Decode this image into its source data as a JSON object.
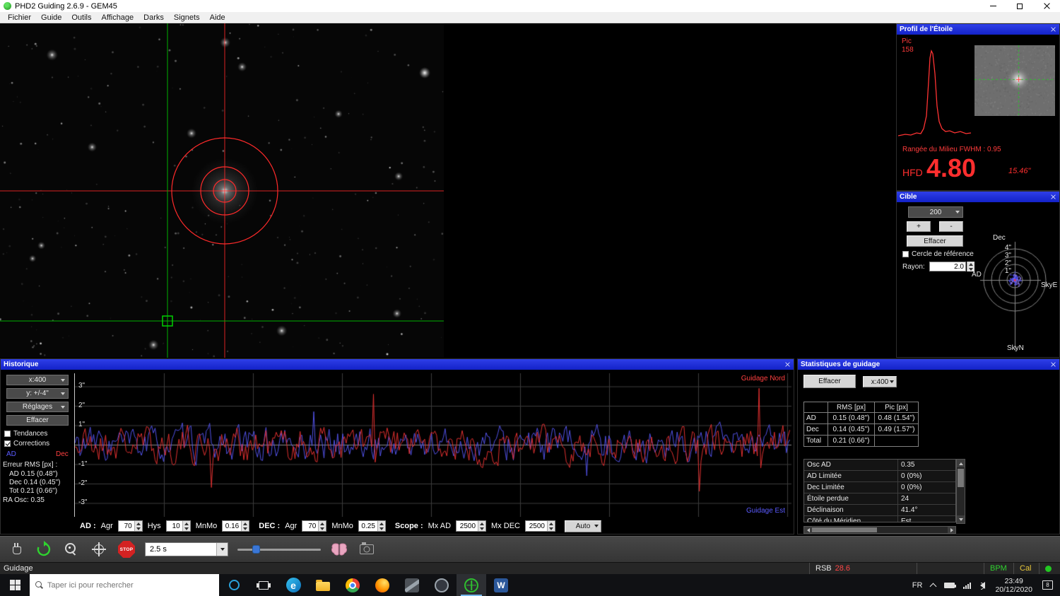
{
  "window": {
    "title": "PHD2 Guiding 2.6.9 - GEM45"
  },
  "menu": {
    "items": [
      "Fichier",
      "Guide",
      "Outils",
      "Affichage",
      "Darks",
      "Signets",
      "Aide"
    ]
  },
  "profile_panel": {
    "title": "Profil de l'Étoile",
    "peak_label": "Pic",
    "peak_value": "158",
    "fwhm_text": "Rangée du Milieu FWHM : 0.95",
    "hfd_label": "HFD",
    "hfd_value": "4.80",
    "hfd_arcsec": "15.46\""
  },
  "target_panel": {
    "title": "Cible",
    "zoom_value": "200",
    "zoom_in": "+",
    "zoom_out": "-",
    "clear_label": "Effacer",
    "ref_circle_label": "Cercle de référence",
    "radius_label": "Rayon:",
    "radius_value": "2.0",
    "axis_dec": "Dec",
    "axis_ad": "AD",
    "sky_east": "SkyE",
    "sky_north": "SkyN",
    "ring_labels": [
      "4\"",
      "3\"",
      "2\"",
      "1\""
    ]
  },
  "history_panel": {
    "title": "Historique",
    "scale_x": "x:400",
    "scale_y": "y: +/-4\"",
    "settings_label": "Réglages",
    "clear_label": "Effacer",
    "trend_label": "Tendances",
    "corrections_label": "Corrections",
    "ad_label": "AD",
    "dec_label": "Dec",
    "rms_title": "Erreur RMS [px] :",
    "rms_ad": "AD 0.15 (0.48\")",
    "rms_dec": "Dec 0.14 (0.45\")",
    "rms_tot": "Tot 0.21 (0.66\")",
    "ra_osc": "RA Osc: 0.35",
    "y_ticks": [
      "3\"",
      "2\"",
      "1\"",
      "-1\"",
      "-2\"",
      "-3\""
    ],
    "legend_north": "Guidage Nord",
    "legend_east": "Guidage Est",
    "param_groups": [
      {
        "group": "AD :",
        "fields": [
          {
            "label": "Agr",
            "value": "70"
          },
          {
            "label": "Hys",
            "value": "10"
          },
          {
            "label": "MnMo",
            "value": "0.16"
          }
        ]
      },
      {
        "group": "DEC :",
        "fields": [
          {
            "label": "Agr",
            "value": "70"
          },
          {
            "label": "MnMo",
            "value": "0.25"
          }
        ]
      },
      {
        "group": "Scope :",
        "fields": [
          {
            "label": "Mx AD",
            "value": "2500"
          },
          {
            "label": "Mx DEC",
            "value": "2500"
          }
        ]
      }
    ],
    "dither_value": "Auto"
  },
  "stats_panel": {
    "title": "Statistiques de guidage",
    "clear_label": "Effacer",
    "scale_x": "x:400",
    "col_rms": "RMS [px]",
    "col_peak": "Pic [px]",
    "rows": [
      {
        "name": "AD",
        "rms": "0.15 (0.48\")",
        "peak": "0.48 (1.54\")"
      },
      {
        "name": "Dec",
        "rms": "0.14 (0.45\")",
        "peak": "0.49 (1.57\")"
      },
      {
        "name": "Total",
        "rms": "0.21 (0.66\")",
        "peak": ""
      }
    ],
    "list": [
      {
        "name": "Osc AD",
        "value": "0.35"
      },
      {
        "name": "AD Limitée",
        "value": "0 (0%)"
      },
      {
        "name": "Dec Limitée",
        "value": "0 (0%)"
      },
      {
        "name": "Étoile perdue",
        "value": "24"
      },
      {
        "name": "Déclinaison",
        "value": "41.4°"
      },
      {
        "name": "Côté du Méridien",
        "value": "Est"
      }
    ]
  },
  "toolbar": {
    "exposure": "2.5 s",
    "stop_label": "STOP"
  },
  "statusbar": {
    "state": "Guidage",
    "rsb_label": "RSB",
    "rsb_value": "28.6",
    "bpm_label": "BPM",
    "cal_label": "Cal"
  },
  "taskbar": {
    "search_placeholder": "Taper ici pour rechercher",
    "lang": "FR",
    "time": "23:49",
    "date": "20/12/2020",
    "badge": "8",
    "word_glyph": "W",
    "edge_glyph": "e"
  }
}
